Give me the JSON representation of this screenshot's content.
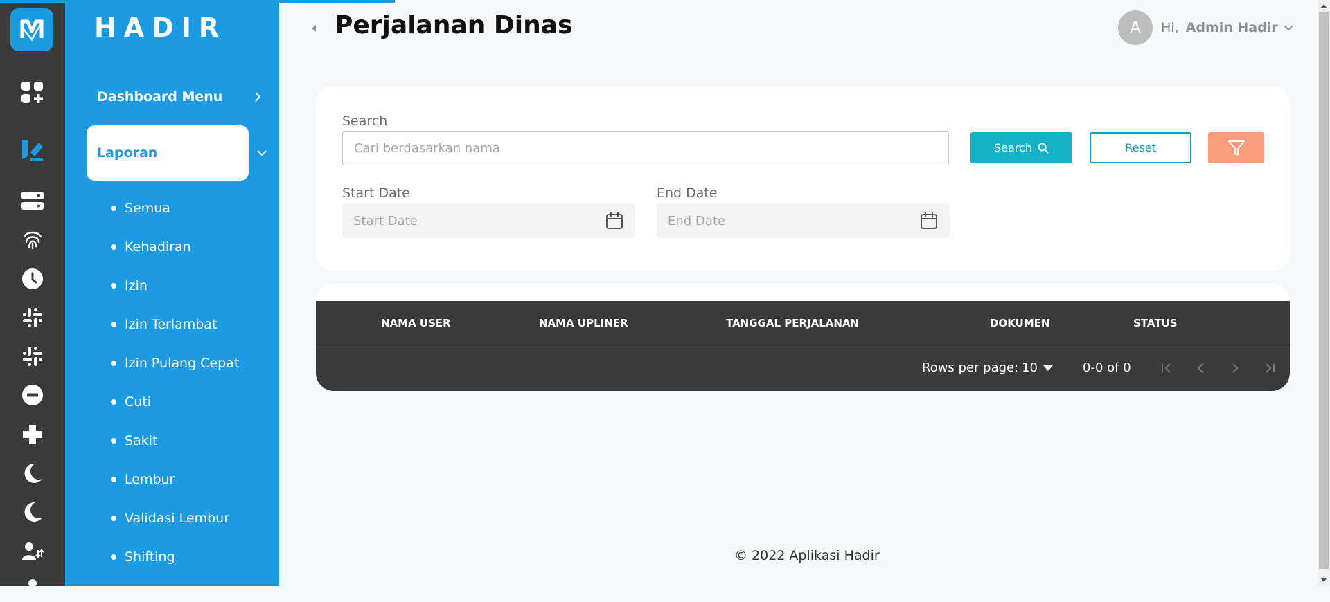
{
  "brand": "HADIR",
  "sidebar": {
    "dashboard_label": "Dashboard Menu",
    "laporan_label": "Laporan",
    "sub_items": [
      "Semua",
      "Kehadiran",
      "Izin",
      "Izin Terlambat",
      "Izin Pulang Cepat",
      "Cuti",
      "Sakit",
      "Lembur",
      "Validasi Lembur",
      "Shifting"
    ]
  },
  "rail": {
    "icons": [
      "add-app-icon",
      "report-icon",
      "server-icon",
      "fingerprint-icon",
      "clock-icon",
      "slack-icon",
      "slack-icon",
      "minus-circle-icon",
      "plus-cross-icon",
      "moon-icon",
      "moon-icon",
      "user-transfer-icon"
    ]
  },
  "header": {
    "title": "Perjalanan Dinas",
    "avatar_letter": "A",
    "greeting": "Hi,",
    "user_name": "Admin Hadir"
  },
  "filter": {
    "search_label": "Search",
    "search_placeholder": "Cari berdasarkan nama",
    "search_button": "Search",
    "reset_button": "Reset",
    "start_date_label": "Start Date",
    "start_date_placeholder": "Start Date",
    "end_date_label": "End Date",
    "end_date_placeholder": "End Date"
  },
  "table": {
    "columns": [
      "NAMA USER",
      "NAMA UPLINER",
      "TANGGAL PERJALANAN",
      "DOKUMEN",
      "STATUS"
    ],
    "rows": [],
    "rows_per_page_label": "Rows per page:",
    "rows_per_page_value": "10",
    "range_text": "0-0 of 0"
  },
  "footer": {
    "copyright": "© 2022 Aplikasi Hadir"
  },
  "colors": {
    "sidebar_blue": "#1d9be2",
    "rail_dark": "#3a3a3a",
    "search_teal": "#13b0c8",
    "filter_salmon": "#f99b7d"
  }
}
